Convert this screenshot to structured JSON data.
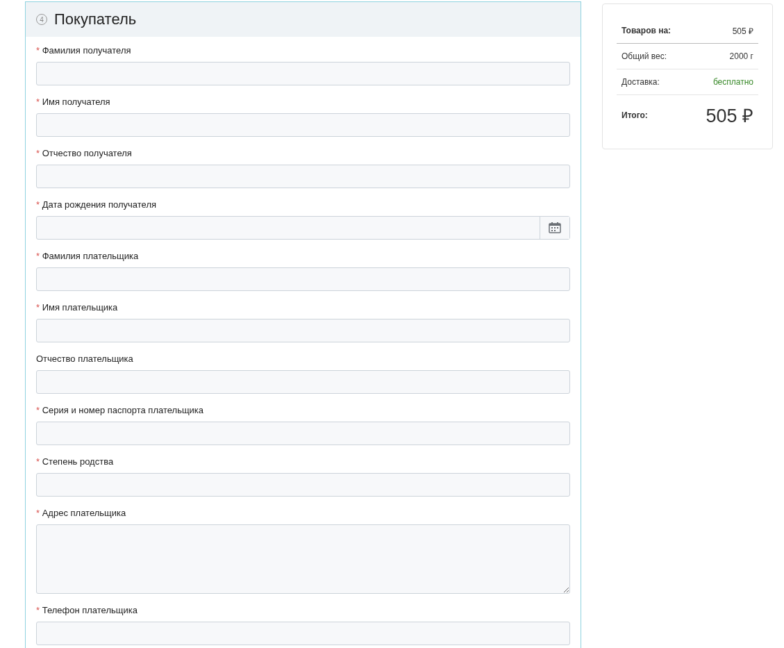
{
  "section": {
    "step": "4",
    "title": "Покупатель",
    "required_marker": "*"
  },
  "fields": [
    {
      "label": "Фамилия получателя",
      "required": true,
      "kind": "text"
    },
    {
      "label": "Имя получателя",
      "required": true,
      "kind": "text"
    },
    {
      "label": "Отчество получателя",
      "required": true,
      "kind": "text"
    },
    {
      "label": "Дата рождения получателя",
      "required": true,
      "kind": "date"
    },
    {
      "label": "Фамилия плательщика",
      "required": true,
      "kind": "text"
    },
    {
      "label": "Имя плательщика",
      "required": true,
      "kind": "text"
    },
    {
      "label": "Отчество плательщика",
      "required": false,
      "kind": "text"
    },
    {
      "label": "Серия и номер паспорта плательщика",
      "required": true,
      "kind": "text"
    },
    {
      "label": "Степень родства",
      "required": true,
      "kind": "text"
    },
    {
      "label": "Адрес плательщика",
      "required": true,
      "kind": "textarea"
    },
    {
      "label": "Телефон плательщика",
      "required": true,
      "kind": "text"
    }
  ],
  "summary": [
    {
      "label": "Товаров на:",
      "value": "505 ₽",
      "kind": "subtotal"
    },
    {
      "label": "Общий вес:",
      "value": "2000 г",
      "kind": "normal"
    },
    {
      "label": "Доставка:",
      "value": "бесплатно",
      "kind": "free"
    },
    {
      "label": "Итого:",
      "value": "505 ₽",
      "kind": "total"
    }
  ]
}
